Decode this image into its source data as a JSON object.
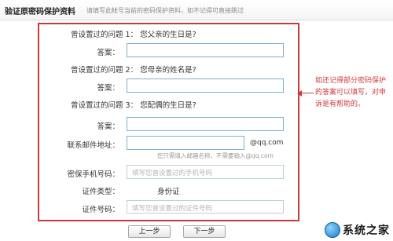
{
  "header": {
    "title": "验证原密码保护资料",
    "subtitle": "请填写此帐号当前的密码保护资料，如不记得可直接跳过"
  },
  "form": {
    "q1": {
      "question": "曾设置过的问题 1：  您父亲的生日是?",
      "answer_label": "答案："
    },
    "q2": {
      "question": "曾设置过的问题 2：  您母亲的姓名是?",
      "answer_label": "答案："
    },
    "q3": {
      "question": "曾设置过的问题 3：  您配偶的生日是?",
      "answer_label": "答案："
    },
    "email": {
      "label": "联系邮件地址：",
      "suffix": "@qq.com",
      "hint": "您只需填入邮箱名称，不需要输入@qq.com"
    },
    "phone": {
      "label": "密保手机号码：",
      "placeholder": "填写您曾设置过的手机号码"
    },
    "id_type": {
      "label": "证件类型：",
      "value": "身份证"
    },
    "id_number": {
      "label": "证件号码：",
      "placeholder": "填写您曾设置过的证件号码"
    }
  },
  "annotation": {
    "text": "如还记得部分密码保护的答案可以填写，对申诉是有帮助的。",
    "color": "#d23a3a"
  },
  "buttons": {
    "prev": "上一步",
    "next": "下一步"
  },
  "watermark": {
    "text": "系统之家",
    "icon": "site-logo-icon"
  }
}
